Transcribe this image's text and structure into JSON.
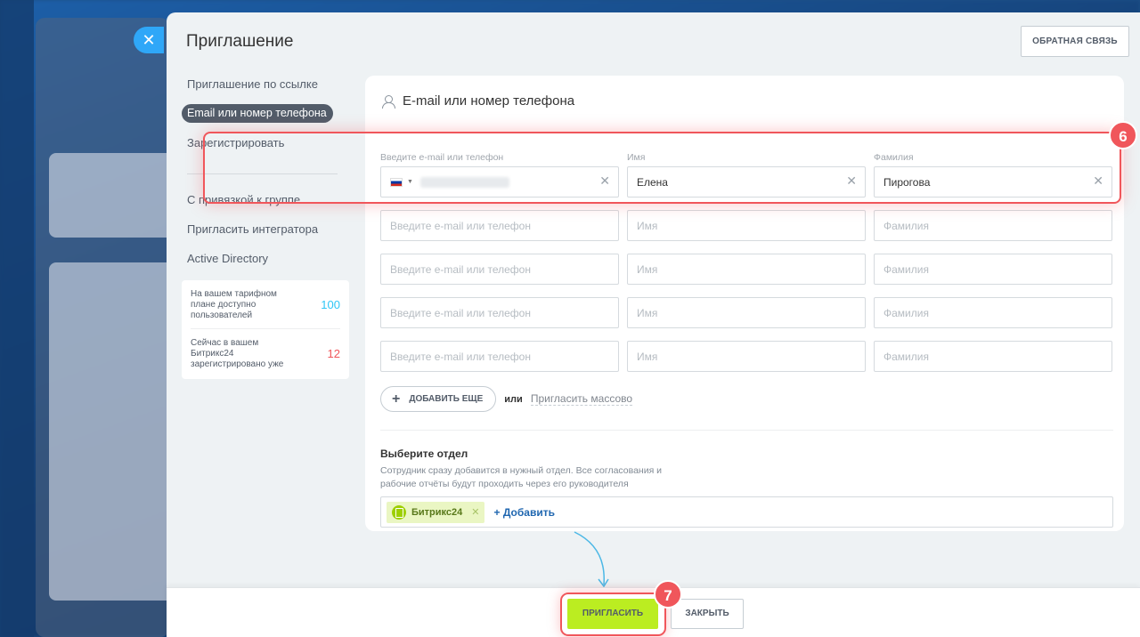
{
  "slider": {
    "title": "Приглашение",
    "feedback_label": "ОБРАТНАЯ СВЯЗЬ",
    "close_icon": "close-icon"
  },
  "sidebar": {
    "items": [
      {
        "label": "Приглашение по ссылке"
      },
      {
        "label": "Email или номер телефона"
      },
      {
        "label": "Зарегистрировать"
      },
      {
        "label": "С привязкой к группе"
      },
      {
        "label": "Пригласить интегратора"
      },
      {
        "label": "Active Directory"
      }
    ],
    "limits": [
      {
        "text": "На вашем тарифном плане доступно пользователей",
        "value": "100",
        "color": "#2fc6f6"
      },
      {
        "text": "Сейчас в вашем Битрикс24 зарегистрировано уже",
        "value": "12",
        "color": "#f0565b"
      }
    ]
  },
  "form": {
    "title": "E-mail или номер телефона",
    "labels": {
      "contact": "Введите e-mail или телефон",
      "name": "Имя",
      "surname": "Фамилия"
    },
    "rows": [
      {
        "contact": "",
        "name": "Елена",
        "surname": "Пирогова"
      },
      {
        "contact": "",
        "name": "",
        "surname": ""
      },
      {
        "contact": "",
        "name": "",
        "surname": ""
      },
      {
        "contact": "",
        "name": "",
        "surname": ""
      },
      {
        "contact": "",
        "name": "",
        "surname": ""
      }
    ],
    "placeholders": {
      "contact": "Введите e-mail или телефон",
      "name": "Имя",
      "surname": "Фамилия"
    },
    "add_more_label": "ДОБАВИТЬ ЕЩЕ",
    "or_label": "или",
    "mass_invite_label": "Пригласить массово",
    "department": {
      "title": "Выберите отдел",
      "description": "Сотрудник сразу добавится в нужный отдел. Все согласования и рабочие отчёты будут проходить через его руководителя",
      "selected": "Битрикс24",
      "add_label": "+ Добавить"
    }
  },
  "footer": {
    "invite_label": "ПРИГЛАСИТЬ",
    "close_label": "ЗАКРЫТЬ"
  },
  "annotations": {
    "step_fields": "6",
    "step_invite": "7",
    "highlight_color": "#f0565b"
  }
}
